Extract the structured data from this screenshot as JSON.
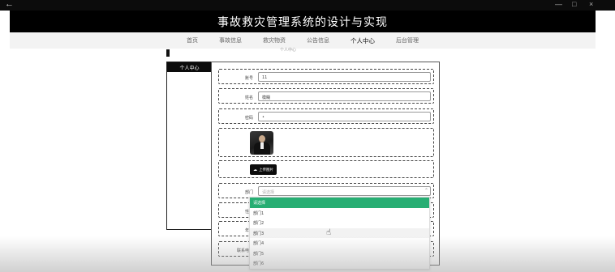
{
  "window": {
    "back_icon": "arrow-left-icon",
    "controls": [
      "—",
      "□",
      "×"
    ]
  },
  "header": {
    "title": "事故救灾管理系统的设计与实现"
  },
  "nav": {
    "items": [
      {
        "label": "首页"
      },
      {
        "label": "事故信息"
      },
      {
        "label": "救灾物资"
      },
      {
        "label": "公告信息"
      },
      {
        "label": "个人中心",
        "active": true
      },
      {
        "label": "后台管理"
      }
    ]
  },
  "breadcrumb": {
    "text": "个人中心"
  },
  "sidebar": {
    "items": [
      {
        "label": "个人中心"
      }
    ]
  },
  "form": {
    "account": {
      "label": "账号",
      "value": "11"
    },
    "name": {
      "label": "姓名",
      "value": "模糊"
    },
    "password": {
      "label": "密码",
      "value": "•"
    },
    "upload": {
      "label": "上传图片",
      "icon": "cloud-upload-icon"
    },
    "dept": {
      "label": "部门",
      "placeholder": "请选择"
    },
    "gender": {
      "label": "性别"
    },
    "age": {
      "label": "年龄"
    },
    "phone": {
      "label": "联系电话"
    }
  },
  "dropdown": {
    "options": [
      "请选择",
      "部门1",
      "部门2",
      "部门3",
      "部门4",
      "部门5",
      "部门6"
    ],
    "selected_index": 0,
    "hover_index": 3
  },
  "colors": {
    "accent": "#27ae73",
    "header_bg": "#000000"
  }
}
